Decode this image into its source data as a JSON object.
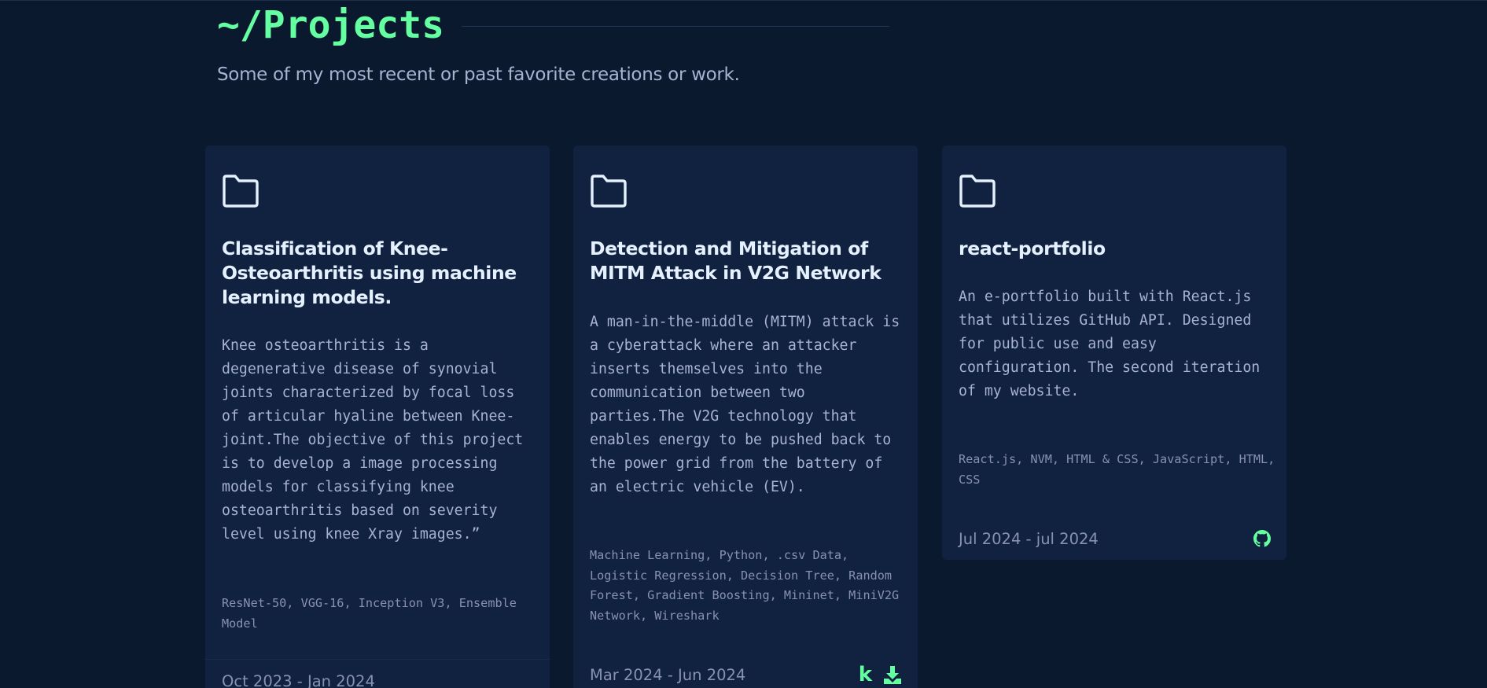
{
  "section": {
    "title": "~/Projects",
    "subtitle": "Some of my most recent or past favorite creations or work."
  },
  "colors": {
    "accent": "#64ffa0",
    "background": "#0b192f",
    "card": "#112240"
  },
  "projects": [
    {
      "icon": "folder-icon",
      "title": "Classification of Knee-Osteoarthritis using machine learning models.",
      "description": "Knee osteoarthritis is a degenerative disease of synovial joints characterized by focal loss of articular hyaline between Knee-joint.The objective of this project is to develop a image processing models for classifying knee osteoarthritis based on severity level using knee Xray images.”",
      "tech": "ResNet-50, VGG-16, Inception V3, Ensemble Model",
      "date": "Oct 2023 - Jan 2024",
      "links": []
    },
    {
      "icon": "folder-icon",
      "title": "Detection and Mitigation of MITM Attack in V2G Network",
      "description": "A man-in-the-middle (MITM) attack is a cyberattack where an attacker inserts themselves into the communication between two parties.The V2G technology that enables energy to be pushed back to the power grid from the battery of an electric vehicle (EV).",
      "tech": "Machine Learning, Python, .csv Data, Logistic Regression, Decision Tree, Random Forest, Gradient Boosting, Mininet, MiniV2G Network, Wireshark",
      "date": "Mar 2024 - Jun 2024",
      "links": [
        {
          "icon": "kaggle-icon",
          "text": "k"
        },
        {
          "icon": "download-icon"
        }
      ]
    },
    {
      "icon": "folder-icon",
      "title": "react-portfolio",
      "description": "An e-portfolio built with React.js that utilizes GitHub API. Designed for public use and easy configuration. The second iteration of my website.",
      "tech": "React.js, NVM, HTML & CSS, JavaScript, HTML, CSS",
      "date": "Jul 2024 - jul 2024",
      "links": [
        {
          "icon": "github-icon"
        }
      ]
    }
  ]
}
